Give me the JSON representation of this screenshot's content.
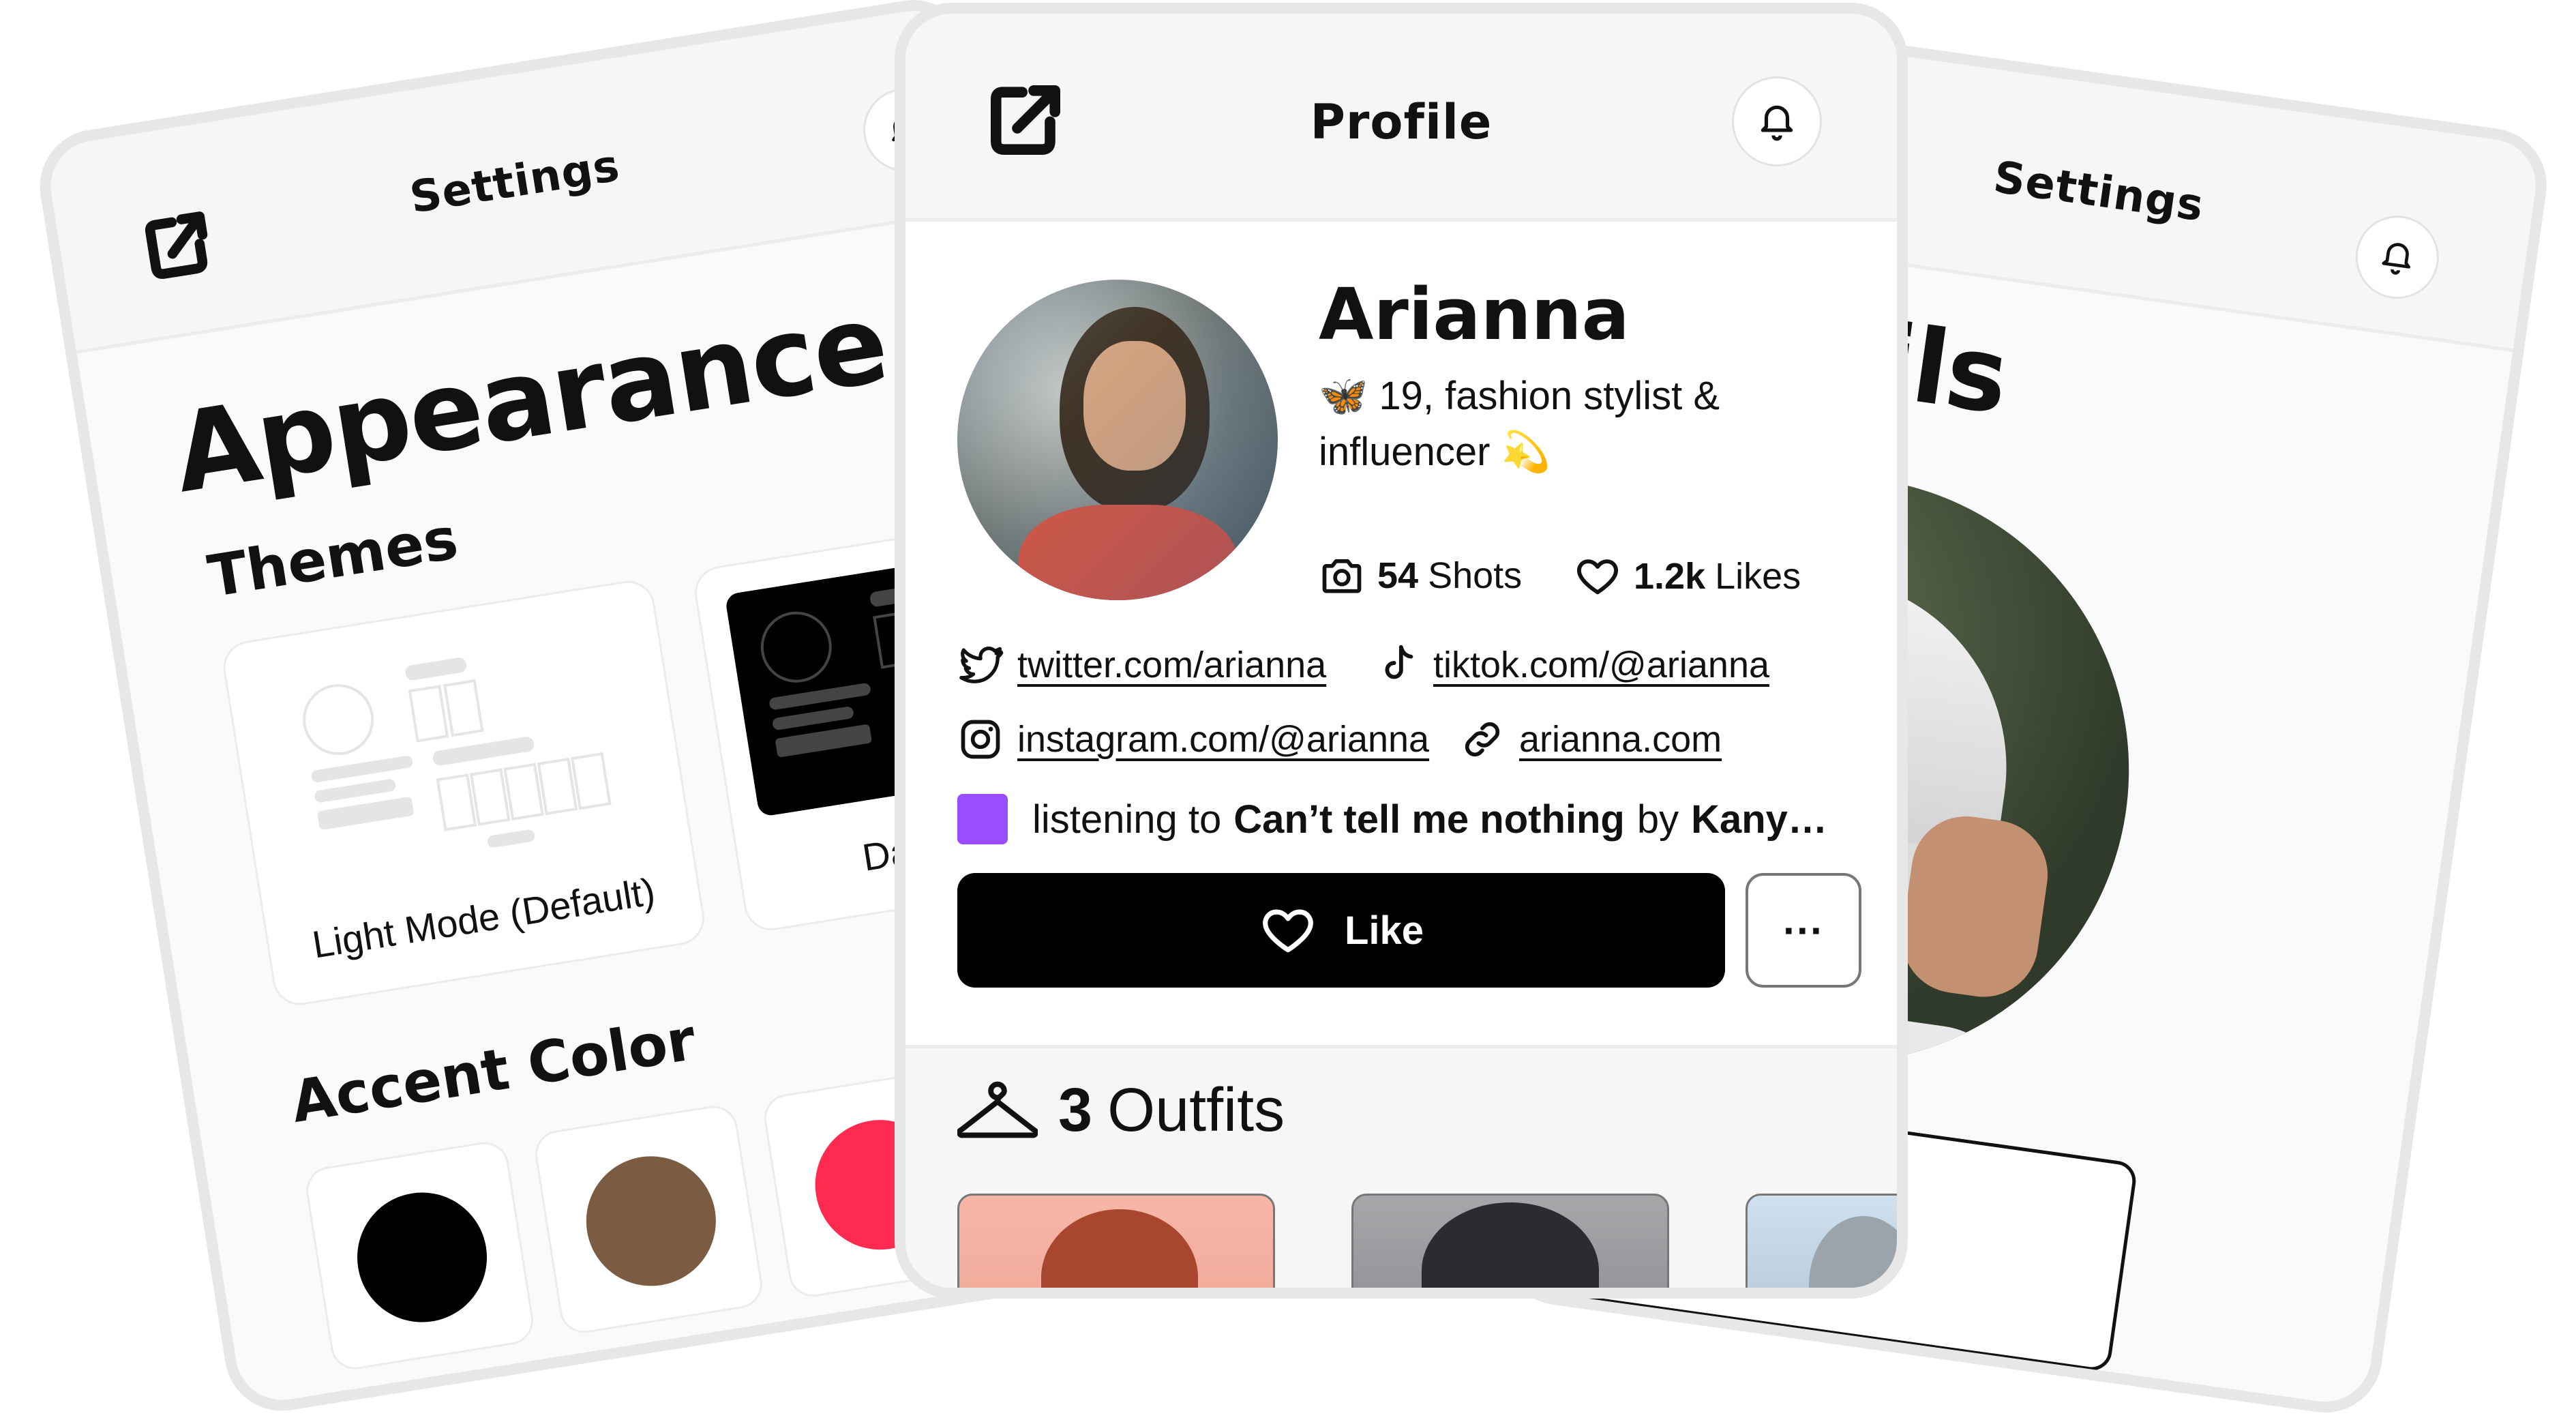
{
  "settings_left": {
    "header_title": "Settings",
    "section_title": "Appearance",
    "themes_heading": "Themes",
    "themes": [
      {
        "label": "Light Mode (Default)"
      },
      {
        "label": "Dark Mode"
      }
    ],
    "accent_heading": "Accent Color",
    "accent_colors": [
      "#000000",
      "#7b5c42",
      "#ff2a4f"
    ]
  },
  "profile": {
    "header_title": "Profile",
    "name": "Arianna",
    "bio_emoji": "🦋",
    "bio_line1": "19, fashion stylist &",
    "bio_line2": "influencer",
    "bio_emoji2": "💫",
    "stats": {
      "shots_count": "54",
      "shots_label": "Shots",
      "likes_count": "1.2k",
      "likes_label": "Likes"
    },
    "links": {
      "twitter": "twitter.com/arianna",
      "tiktok": "tiktok.com/@arianna",
      "instagram": "instagram.com/@arianna",
      "website": "arianna.com"
    },
    "listening": {
      "prefix": "listening to",
      "song": "Can’t tell me nothing",
      "by": "by",
      "artist": "Kany…",
      "swatch_color": "#9a4dff"
    },
    "like_button": "Like",
    "more_button": "···",
    "outfits_count": "3",
    "outfits_label": "Outfits"
  },
  "settings_right": {
    "header_title": "Settings",
    "section_title": "Details"
  }
}
